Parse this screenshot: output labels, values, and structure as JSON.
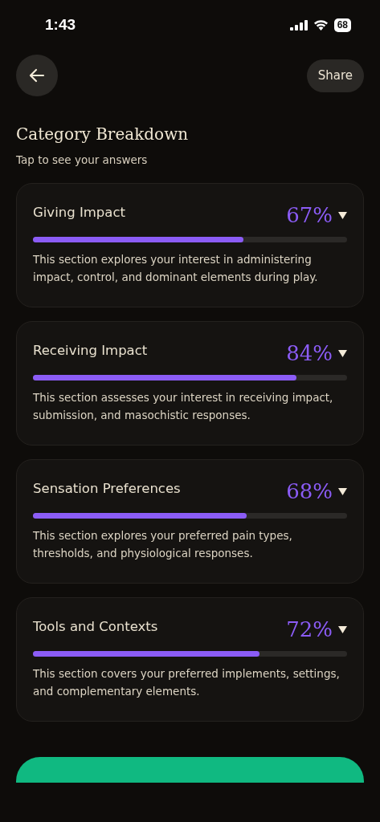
{
  "status_bar": {
    "time": "1:43",
    "battery": "68"
  },
  "header": {
    "share_label": "Share"
  },
  "title": "Category Breakdown",
  "subtitle": "Tap to see your answers",
  "categories": [
    {
      "name": "Giving Impact",
      "percent": "67%",
      "level": 0.67,
      "expanded": false,
      "description": "This section explores your interest in administering impact, control, and dominant elements during play."
    },
    {
      "name": "Receiving Impact",
      "percent": "84%",
      "level": 0.84,
      "expanded": false,
      "description": "This section assesses your interest in receiving impact, submission, and masochistic responses."
    },
    {
      "name": "Sensation Preferences",
      "percent": "68%",
      "level": 0.68,
      "expanded": false,
      "description": "This section explores your preferred pain types, thresholds, and physiological responses."
    },
    {
      "name": "Tools and Contexts",
      "percent": "72%",
      "level": 0.72,
      "expanded": false,
      "description": "This section covers your preferred implements, settings, and complementary elements."
    }
  ]
}
